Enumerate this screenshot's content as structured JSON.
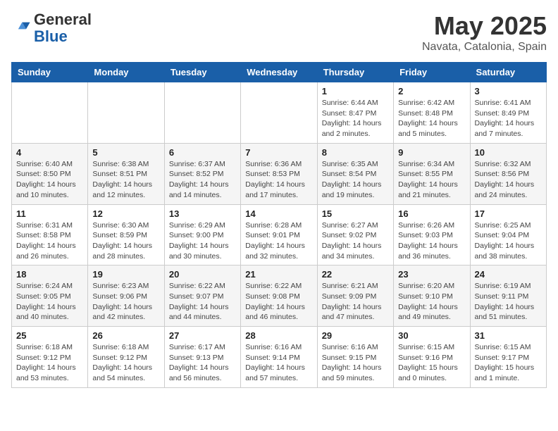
{
  "header": {
    "logo_general": "General",
    "logo_blue": "Blue",
    "month_title": "May 2025",
    "location": "Navata, Catalonia, Spain"
  },
  "days_of_week": [
    "Sunday",
    "Monday",
    "Tuesday",
    "Wednesday",
    "Thursday",
    "Friday",
    "Saturday"
  ],
  "weeks": [
    [
      {
        "day": "",
        "info": ""
      },
      {
        "day": "",
        "info": ""
      },
      {
        "day": "",
        "info": ""
      },
      {
        "day": "",
        "info": ""
      },
      {
        "day": "1",
        "info": "Sunrise: 6:44 AM\nSunset: 8:47 PM\nDaylight: 14 hours\nand 2 minutes."
      },
      {
        "day": "2",
        "info": "Sunrise: 6:42 AM\nSunset: 8:48 PM\nDaylight: 14 hours\nand 5 minutes."
      },
      {
        "day": "3",
        "info": "Sunrise: 6:41 AM\nSunset: 8:49 PM\nDaylight: 14 hours\nand 7 minutes."
      }
    ],
    [
      {
        "day": "4",
        "info": "Sunrise: 6:40 AM\nSunset: 8:50 PM\nDaylight: 14 hours\nand 10 minutes."
      },
      {
        "day": "5",
        "info": "Sunrise: 6:38 AM\nSunset: 8:51 PM\nDaylight: 14 hours\nand 12 minutes."
      },
      {
        "day": "6",
        "info": "Sunrise: 6:37 AM\nSunset: 8:52 PM\nDaylight: 14 hours\nand 14 minutes."
      },
      {
        "day": "7",
        "info": "Sunrise: 6:36 AM\nSunset: 8:53 PM\nDaylight: 14 hours\nand 17 minutes."
      },
      {
        "day": "8",
        "info": "Sunrise: 6:35 AM\nSunset: 8:54 PM\nDaylight: 14 hours\nand 19 minutes."
      },
      {
        "day": "9",
        "info": "Sunrise: 6:34 AM\nSunset: 8:55 PM\nDaylight: 14 hours\nand 21 minutes."
      },
      {
        "day": "10",
        "info": "Sunrise: 6:32 AM\nSunset: 8:56 PM\nDaylight: 14 hours\nand 24 minutes."
      }
    ],
    [
      {
        "day": "11",
        "info": "Sunrise: 6:31 AM\nSunset: 8:58 PM\nDaylight: 14 hours\nand 26 minutes."
      },
      {
        "day": "12",
        "info": "Sunrise: 6:30 AM\nSunset: 8:59 PM\nDaylight: 14 hours\nand 28 minutes."
      },
      {
        "day": "13",
        "info": "Sunrise: 6:29 AM\nSunset: 9:00 PM\nDaylight: 14 hours\nand 30 minutes."
      },
      {
        "day": "14",
        "info": "Sunrise: 6:28 AM\nSunset: 9:01 PM\nDaylight: 14 hours\nand 32 minutes."
      },
      {
        "day": "15",
        "info": "Sunrise: 6:27 AM\nSunset: 9:02 PM\nDaylight: 14 hours\nand 34 minutes."
      },
      {
        "day": "16",
        "info": "Sunrise: 6:26 AM\nSunset: 9:03 PM\nDaylight: 14 hours\nand 36 minutes."
      },
      {
        "day": "17",
        "info": "Sunrise: 6:25 AM\nSunset: 9:04 PM\nDaylight: 14 hours\nand 38 minutes."
      }
    ],
    [
      {
        "day": "18",
        "info": "Sunrise: 6:24 AM\nSunset: 9:05 PM\nDaylight: 14 hours\nand 40 minutes."
      },
      {
        "day": "19",
        "info": "Sunrise: 6:23 AM\nSunset: 9:06 PM\nDaylight: 14 hours\nand 42 minutes."
      },
      {
        "day": "20",
        "info": "Sunrise: 6:22 AM\nSunset: 9:07 PM\nDaylight: 14 hours\nand 44 minutes."
      },
      {
        "day": "21",
        "info": "Sunrise: 6:22 AM\nSunset: 9:08 PM\nDaylight: 14 hours\nand 46 minutes."
      },
      {
        "day": "22",
        "info": "Sunrise: 6:21 AM\nSunset: 9:09 PM\nDaylight: 14 hours\nand 47 minutes."
      },
      {
        "day": "23",
        "info": "Sunrise: 6:20 AM\nSunset: 9:10 PM\nDaylight: 14 hours\nand 49 minutes."
      },
      {
        "day": "24",
        "info": "Sunrise: 6:19 AM\nSunset: 9:11 PM\nDaylight: 14 hours\nand 51 minutes."
      }
    ],
    [
      {
        "day": "25",
        "info": "Sunrise: 6:18 AM\nSunset: 9:12 PM\nDaylight: 14 hours\nand 53 minutes."
      },
      {
        "day": "26",
        "info": "Sunrise: 6:18 AM\nSunset: 9:12 PM\nDaylight: 14 hours\nand 54 minutes."
      },
      {
        "day": "27",
        "info": "Sunrise: 6:17 AM\nSunset: 9:13 PM\nDaylight: 14 hours\nand 56 minutes."
      },
      {
        "day": "28",
        "info": "Sunrise: 6:16 AM\nSunset: 9:14 PM\nDaylight: 14 hours\nand 57 minutes."
      },
      {
        "day": "29",
        "info": "Sunrise: 6:16 AM\nSunset: 9:15 PM\nDaylight: 14 hours\nand 59 minutes."
      },
      {
        "day": "30",
        "info": "Sunrise: 6:15 AM\nSunset: 9:16 PM\nDaylight: 15 hours\nand 0 minutes."
      },
      {
        "day": "31",
        "info": "Sunrise: 6:15 AM\nSunset: 9:17 PM\nDaylight: 15 hours\nand 1 minute."
      }
    ]
  ]
}
